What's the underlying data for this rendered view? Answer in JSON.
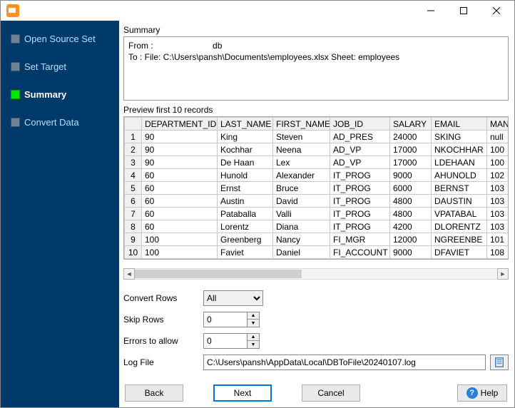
{
  "sidebar": {
    "items": [
      {
        "label": "Open Source Set",
        "active": false
      },
      {
        "label": "Set Target",
        "active": false
      },
      {
        "label": "Summary",
        "active": true
      },
      {
        "label": "Convert Data",
        "active": false
      }
    ]
  },
  "summary": {
    "heading": "Summary",
    "line1_label": "From :",
    "line1_value": "db",
    "line2": "To : File: C:\\Users\\pansh\\Documents\\employees.xlsx Sheet: employees"
  },
  "preview": {
    "heading": "Preview first 10 records",
    "columns": [
      "DEPARTMENT_ID",
      "LAST_NAME",
      "FIRST_NAME",
      "JOB_ID",
      "SALARY",
      "EMAIL",
      "MANAG"
    ],
    "rows": [
      [
        "90",
        "King",
        "Steven",
        "AD_PRES",
        "24000",
        "SKING",
        "null"
      ],
      [
        "90",
        "Kochhar",
        "Neena",
        "AD_VP",
        "17000",
        "NKOCHHAR",
        "100"
      ],
      [
        "90",
        "De Haan",
        "Lex",
        "AD_VP",
        "17000",
        "LDEHAAN",
        "100"
      ],
      [
        "60",
        "Hunold",
        "Alexander",
        "IT_PROG",
        "9000",
        "AHUNOLD",
        "102"
      ],
      [
        "60",
        "Ernst",
        "Bruce",
        "IT_PROG",
        "6000",
        "BERNST",
        "103"
      ],
      [
        "60",
        "Austin",
        "David",
        "IT_PROG",
        "4800",
        "DAUSTIN",
        "103"
      ],
      [
        "60",
        "Pataballa",
        "Valli",
        "IT_PROG",
        "4800",
        "VPATABAL",
        "103"
      ],
      [
        "60",
        "Lorentz",
        "Diana",
        "IT_PROG",
        "4200",
        "DLORENTZ",
        "103"
      ],
      [
        "100",
        "Greenberg",
        "Nancy",
        "FI_MGR",
        "12000",
        "NGREENBE",
        "101"
      ],
      [
        "100",
        "Faviet",
        "Daniel",
        "FI_ACCOUNT",
        "9000",
        "DFAVIET",
        "108"
      ]
    ]
  },
  "form": {
    "convert_rows_label": "Convert Rows",
    "convert_rows_value": "All",
    "skip_rows_label": "Skip Rows",
    "skip_rows_value": "0",
    "errors_label": "Errors to allow",
    "errors_value": "0",
    "logfile_label": "Log File",
    "logfile_value": "C:\\Users\\pansh\\AppData\\Local\\DBToFile\\20240107.log"
  },
  "buttons": {
    "back": "Back",
    "next": "Next",
    "cancel": "Cancel",
    "help": "Help"
  }
}
